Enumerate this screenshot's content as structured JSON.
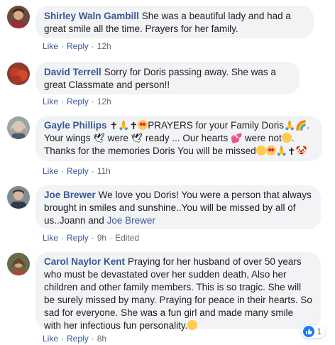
{
  "actions": {
    "like": "Like",
    "reply": "Reply",
    "separator": "·",
    "edited": "Edited"
  },
  "comments": [
    {
      "author": "Shirley Waln Gambill",
      "text": "She was a beautiful lady and had a great smile all the time. Prayers for her family.",
      "time": "12h"
    },
    {
      "author": "David Terrell",
      "text": "Sorry for Doris passing away. She was a great Classmate and person!!",
      "time": "12h"
    },
    {
      "author": "Gayle Phillips",
      "text_a": "PRAYERS for your Family Doris",
      "text_b": "Your wings",
      "text_c": "were",
      "text_d": "ready ... Our hearts",
      "text_e": "were not",
      "text_f": "Thanks for the memories Doris You will be missed",
      "time": "11h"
    },
    {
      "author": "Joe Brewer",
      "text": "We love you Doris! You were a person that always brought in smiles and sunshine..You will be missed by all of us..Joann and",
      "mention": "Joe Brewer",
      "time": "9h"
    },
    {
      "author": "Carol Naylor Kent",
      "text": "Praying for her husband of over 50 years who must be devastated over her sudden death, Also her children and other family members. This is so tragic. She will be surely missed by many. Praying for peace in their hearts. So sad for everyone. She was a fun girl and made many smile with her infectious fun personality.",
      "time": "8h",
      "reaction_count": "1"
    }
  ],
  "colors": {
    "link": "#385898",
    "bubble": "#f2f3f5",
    "like_blue": "#1877f2"
  }
}
